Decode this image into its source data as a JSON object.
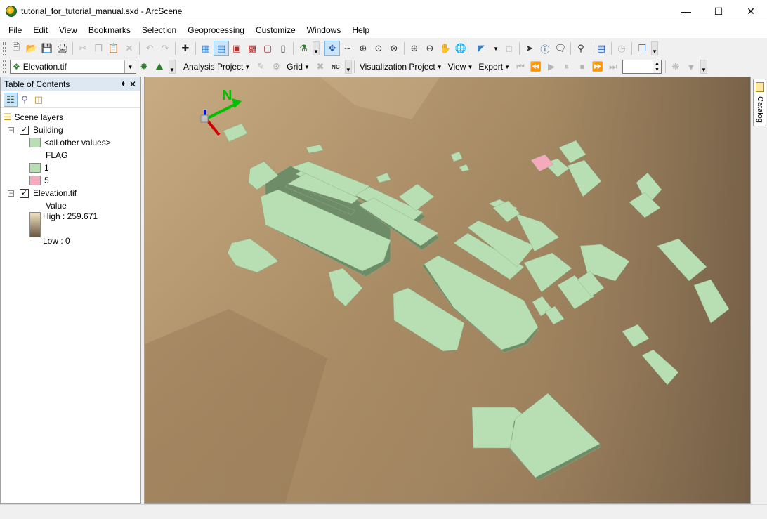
{
  "window": {
    "title": "tutorial_for_tutorial_manual.sxd - ArcScene",
    "minimize": "—",
    "maximize": "☐",
    "close": "✕"
  },
  "menu": [
    "File",
    "Edit",
    "View",
    "Bookmarks",
    "Selection",
    "Geoprocessing",
    "Customize",
    "Windows",
    "Help"
  ],
  "toolbar2": {
    "layer_select": "Elevation.tif",
    "analysis_project": "Analysis Project",
    "grid": "Grid",
    "nc_label": "NC",
    "visualization_project": "Visualization Project",
    "view": "View",
    "export": "Export",
    "frame_value": ""
  },
  "toc": {
    "title": "Table of Contents",
    "pin": "⬧",
    "close": "✕",
    "scene_layers": "Scene layers",
    "layers": [
      {
        "name": "Building",
        "checked": true,
        "all_other": "<all other values>",
        "field": "FLAG",
        "classes": [
          {
            "label": "1",
            "color": "#b8dfb3"
          },
          {
            "label": "5",
            "color": "#f4a9bd"
          }
        ]
      },
      {
        "name": "Elevation.tif",
        "checked": true,
        "field": "Value",
        "high": "High : 259.671",
        "low": "Low : 0"
      }
    ]
  },
  "scene": {
    "north_label": "N",
    "terrain_color": "#a88b63",
    "building_color": "#b8dfb3",
    "building_side": "#6f8c68",
    "highlight_color": "#f4a9bd"
  },
  "catalog": {
    "label": "Catalog"
  }
}
